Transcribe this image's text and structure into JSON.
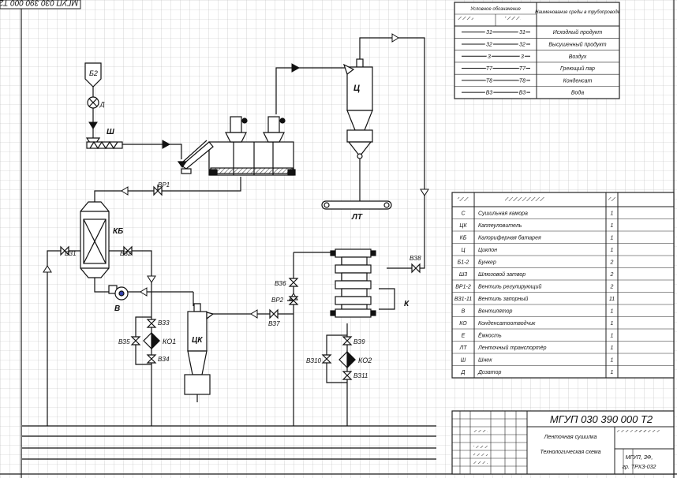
{
  "corner_stamp": "МГУП 030 390 000 Т2",
  "legend": {
    "header_left": "Условное обозначение",
    "header_right": "Наименование среды в трубопроводе",
    "rows": [
      {
        "code": "31",
        "name": "Исходный продукт"
      },
      {
        "code": "32",
        "name": "Высушенный продукт"
      },
      {
        "code": "3",
        "name": "Воздух"
      },
      {
        "code": "Т7",
        "name": "Греющий пар"
      },
      {
        "code": "Т8",
        "name": "Конденсат"
      },
      {
        "code": "В3",
        "name": "Вода"
      }
    ]
  },
  "equipment_labels": {
    "b2": "Б2",
    "d": "Д",
    "sh": "Ш",
    "ts": "Ц",
    "lt": "ЛТ",
    "kb": "КБ",
    "v": "В",
    "tsk": "ЦК",
    "k": "К",
    "ko1": "КО1",
    "ko2": "КО2",
    "vr1": "ВР1",
    "vr2": "ВР2",
    "vz1": "ВЗ1",
    "vz2": "ВЗ2",
    "vz3": "ВЗ3",
    "vz4": "ВЗ4",
    "vz5": "ВЗ5",
    "vz6": "ВЗ6",
    "vz7": "ВЗ7",
    "vz8": "ВЗ8",
    "vz9": "ВЗ9",
    "vz10": "ВЗ10",
    "vz11": "ВЗ11"
  },
  "spec": {
    "rows": [
      {
        "pos": "С",
        "name": "Сушильная камора",
        "qty": "1"
      },
      {
        "pos": "ЦК",
        "name": "Каплеуловитель",
        "qty": "1"
      },
      {
        "pos": "КБ",
        "name": "Калориферная батарея",
        "qty": "1"
      },
      {
        "pos": "Ц",
        "name": "Циклон",
        "qty": "1"
      },
      {
        "pos": "Б1-2",
        "name": "Бункер",
        "qty": "2"
      },
      {
        "pos": "Ш3",
        "name": "Шлюзовой затвор",
        "qty": "2"
      },
      {
        "pos": "ВР1-2",
        "name": "Вентиль регулирующий",
        "qty": "2"
      },
      {
        "pos": "ВЗ1-11",
        "name": "Вентиль запорный",
        "qty": "11"
      },
      {
        "pos": "В",
        "name": "Вентилятор",
        "qty": "1"
      },
      {
        "pos": "КО",
        "name": "Конденсатоотводчик",
        "qty": "1"
      },
      {
        "pos": "Е",
        "name": "Ёмкость",
        "qty": "1"
      },
      {
        "pos": "ЛТ",
        "name": "Ленточный транспортёр",
        "qty": "1"
      },
      {
        "pos": "Ш",
        "name": "Шнек",
        "qty": "1"
      },
      {
        "pos": "Д",
        "name": "Дозатор",
        "qty": "1"
      }
    ]
  },
  "title_block": {
    "code": "МГУП 030 390 000 Т2",
    "name1": "Ленточная сушилка",
    "name2": "Технологическая схема",
    "org1": "МГУП, ЗФ,",
    "org2": "гр. ТРХЗ-032"
  }
}
